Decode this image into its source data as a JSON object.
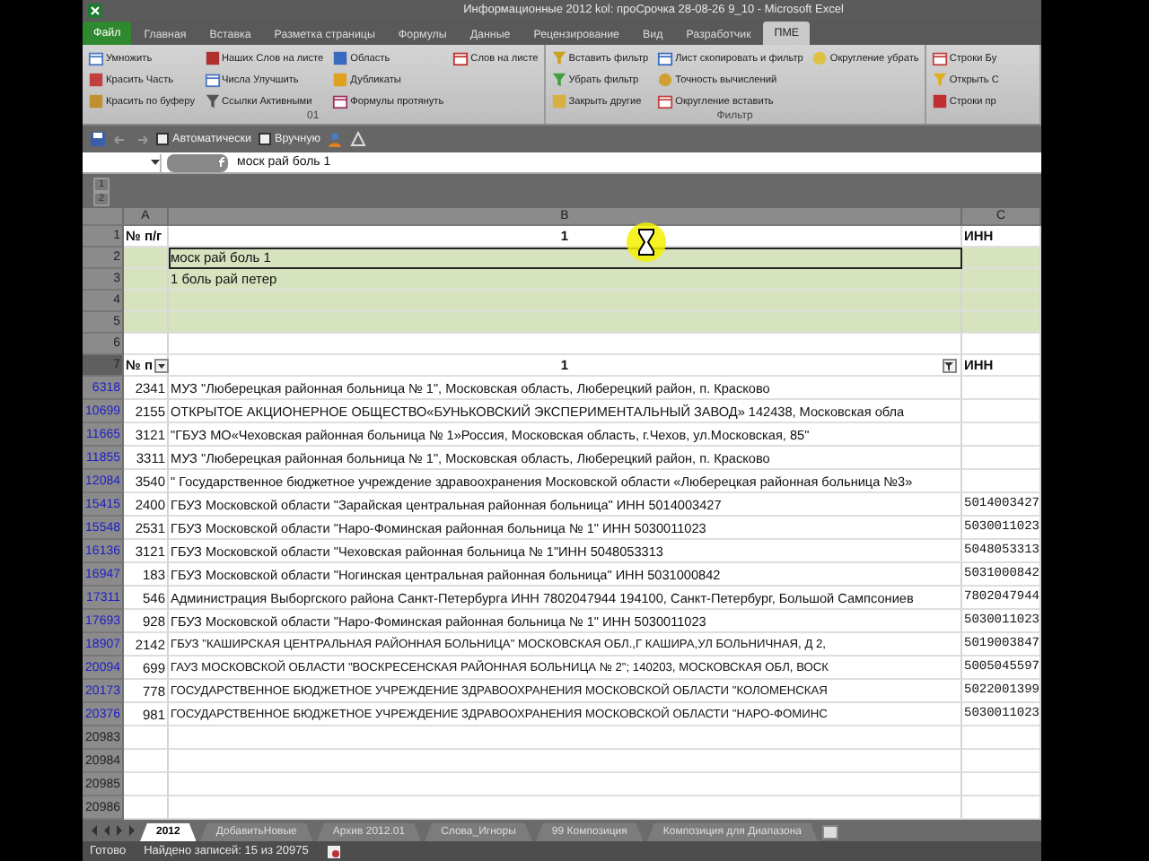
{
  "window": {
    "title": "Информационные 2012 kol: проСрочка 28-08-26 9_10  -  Microsoft Excel"
  },
  "ribbon_tabs": [
    {
      "label": "Файл",
      "kind": "file",
      "selected": false
    },
    {
      "label": "Главная",
      "kind": "tab",
      "selected": false
    },
    {
      "label": "Вставка",
      "kind": "tab",
      "selected": false
    },
    {
      "label": "Разметка страницы",
      "kind": "tab",
      "selected": false
    },
    {
      "label": "Формулы",
      "kind": "tab",
      "selected": false
    },
    {
      "label": "Данные",
      "kind": "tab",
      "selected": false
    },
    {
      "label": "Рецензирование",
      "kind": "tab",
      "selected": false
    },
    {
      "label": "Вид",
      "kind": "tab",
      "selected": false
    },
    {
      "label": "Разработчик",
      "kind": "tab",
      "selected": false
    },
    {
      "label": "ПМЕ",
      "kind": "tab",
      "selected": true
    }
  ],
  "ribbon_groups": [
    {
      "label": "01",
      "columns": [
        [
          "Умножить",
          "Красить Часть",
          "Красить по буферу"
        ],
        [
          "Наших Слов на листе",
          "Числа Улучшить",
          "Ссылки Активными"
        ],
        [
          "Область",
          "Дубликаты",
          "Формулы протянуть"
        ],
        [
          "Слов на листе"
        ]
      ]
    },
    {
      "label": "Фильтр",
      "columns": [
        [
          "Вставить фильтр",
          "Убрать фильтр",
          "Закрыть другие"
        ],
        [
          "Лист скопировать и фильтр",
          "Точность вычислений",
          "Округление вставить"
        ],
        [
          "Округление убрать"
        ]
      ]
    },
    {
      "columns": [
        [
          "Строки Бу",
          "Открыть С",
          "Строки пр"
        ]
      ]
    }
  ],
  "quick_access": {
    "options": [
      "Автоматически",
      "Вручную"
    ]
  },
  "formula_bar": {
    "value": "моск рай боль 1"
  },
  "outline_levels": [
    "1",
    "2"
  ],
  "column_headers": [
    "A",
    "B",
    "C"
  ],
  "top_rows": [
    {
      "row": "1",
      "kind": "header",
      "a": "№ п/г",
      "b": "1",
      "c": "ИНН",
      "shaded": false,
      "selected": false
    },
    {
      "row": "2",
      "kind": "data",
      "b": "моск рай боль 1",
      "shaded": true,
      "selected": true
    },
    {
      "row": "3",
      "kind": "data",
      "b": "1 боль рай петер",
      "shaded": true,
      "selected": false
    },
    {
      "row": "4",
      "kind": "data",
      "shaded": true,
      "selected": false
    },
    {
      "row": "5",
      "kind": "data",
      "shaded": true,
      "selected": false
    },
    {
      "row": "6",
      "kind": "data",
      "shaded": false,
      "selected": false
    },
    {
      "row": "7",
      "kind": "filter_header",
      "a": "№ п",
      "b": "1",
      "c": "ИНН",
      "shaded": false,
      "selected": false
    }
  ],
  "data_rows": [
    {
      "row": "6318",
      "filtered": true,
      "a": "2341",
      "b": "МУЗ \"Люберецкая районная больница № 1\", Московская область, Люберецкий район, п. Красково"
    },
    {
      "row": "10699",
      "filtered": true,
      "a": "2155",
      "b": "ОТКРЫТОЕ АКЦИОНЕРНОЕ ОБЩЕСТВО«БУНЬКОВСКИЙ ЭКСПЕРИМЕНТАЛЬНЫЙ ЗАВОД» 142438, Московская обла"
    },
    {
      "row": "11665",
      "filtered": true,
      "a": "3121",
      "b": "\"ГБУЗ МО«Чеховская районная больница № 1»Россия, Московская область, г.Чехов, ул.Московская, 85\""
    },
    {
      "row": "11855",
      "filtered": true,
      "a": "3311",
      "b": "МУЗ \"Люберецкая районная больница № 1\", Московская область, Люберецкий район, п. Красково"
    },
    {
      "row": "12084",
      "filtered": true,
      "a": "3540",
      "b": "\" Государственное бюджетное учреждение здравоохранения Московской области «Люберецкая районная больница №3»"
    },
    {
      "row": "15415",
      "filtered": true,
      "a": "2400",
      "b": "ГБУЗ Московской области \"Зарайская центральная районная больница\" ИНН 5014003427",
      "c": "5014003427"
    },
    {
      "row": "15548",
      "filtered": true,
      "a": "2531",
      "b": "ГБУЗ Московской области \"Наро-Фоминская районная больница № 1\" ИНН 5030011023",
      "c": "5030011023"
    },
    {
      "row": "16136",
      "filtered": true,
      "a": "3121",
      "b": "ГБУЗ Московской области \"Чеховская районная больница № 1\"ИНН 5048053313",
      "c": "5048053313"
    },
    {
      "row": "16947",
      "filtered": true,
      "a": "183",
      "b": "ГБУЗ Московской области \"Ногинская центральная районная больница\" ИНН 5031000842",
      "c": "5031000842"
    },
    {
      "row": "17311",
      "filtered": true,
      "a": "546",
      "b": "Администрация Выборгского района Санкт-Петербурга ИНН 7802047944 194100, Санкт-Петербург, Большой Сампсониев",
      "c": "7802047944"
    },
    {
      "row": "17693",
      "filtered": true,
      "a": "928",
      "b": "ГБУЗ Московской области \"Наро-Фоминская районная больница № 1\" ИНН 5030011023",
      "c": "5030011023"
    },
    {
      "row": "18907",
      "filtered": true,
      "a": "2142",
      "b": "ГБУЗ \"КАШИРСКАЯ ЦЕНТРАЛЬНАЯ РАЙОННАЯ БОЛЬНИЦА\" МОСКОВСКАЯ ОБЛ.,Г КАШИРА,УЛ БОЛЬНИЧНАЯ, Д 2,",
      "c": "5019003847"
    },
    {
      "row": "20094",
      "filtered": true,
      "a": "699",
      "b": "ГАУЗ МОСКОВСКОЙ ОБЛАСТИ \"ВОСКРЕСЕНСКАЯ РАЙОННАЯ БОЛЬНИЦА № 2\"; 140203, МОСКОВСКАЯ ОБЛ, ВОСК",
      "c": "5005045597"
    },
    {
      "row": "20173",
      "filtered": true,
      "a": "778",
      "b": "ГОСУДАРСТВЕННОЕ БЮДЖЕТНОЕ УЧРЕЖДЕНИЕ ЗДРАВООХРАНЕНИЯ МОСКОВСКОЙ ОБЛАСТИ \"КОЛОМЕНСКАЯ",
      "c": "5022001399"
    },
    {
      "row": "20376",
      "filtered": true,
      "a": "981",
      "b": "ГОСУДАРСТВЕННОЕ БЮДЖЕТНОЕ УЧРЕЖДЕНИЕ ЗДРАВООХРАНЕНИЯ МОСКОВСКОЙ ОБЛАСТИ \"НАРО-ФОМИНС",
      "c": "5030011023"
    },
    {
      "row": "20983",
      "filtered": false
    },
    {
      "row": "20984",
      "filtered": false
    },
    {
      "row": "20985",
      "filtered": false
    },
    {
      "row": "20986",
      "filtered": false
    }
  ],
  "sheet_tabs": [
    {
      "label": "2012",
      "selected": true
    },
    {
      "label": "ДобавитьНовые",
      "selected": false
    },
    {
      "label": "Архив 2012.01",
      "selected": false
    },
    {
      "label": "Слова_Игноры",
      "selected": false
    },
    {
      "label": "99 Композиция",
      "selected": false
    },
    {
      "label": "Композиция для Диапазона",
      "selected": false
    }
  ],
  "status_bar": {
    "state": "Готово",
    "message": "Найдено записей: 15 из 20975"
  }
}
